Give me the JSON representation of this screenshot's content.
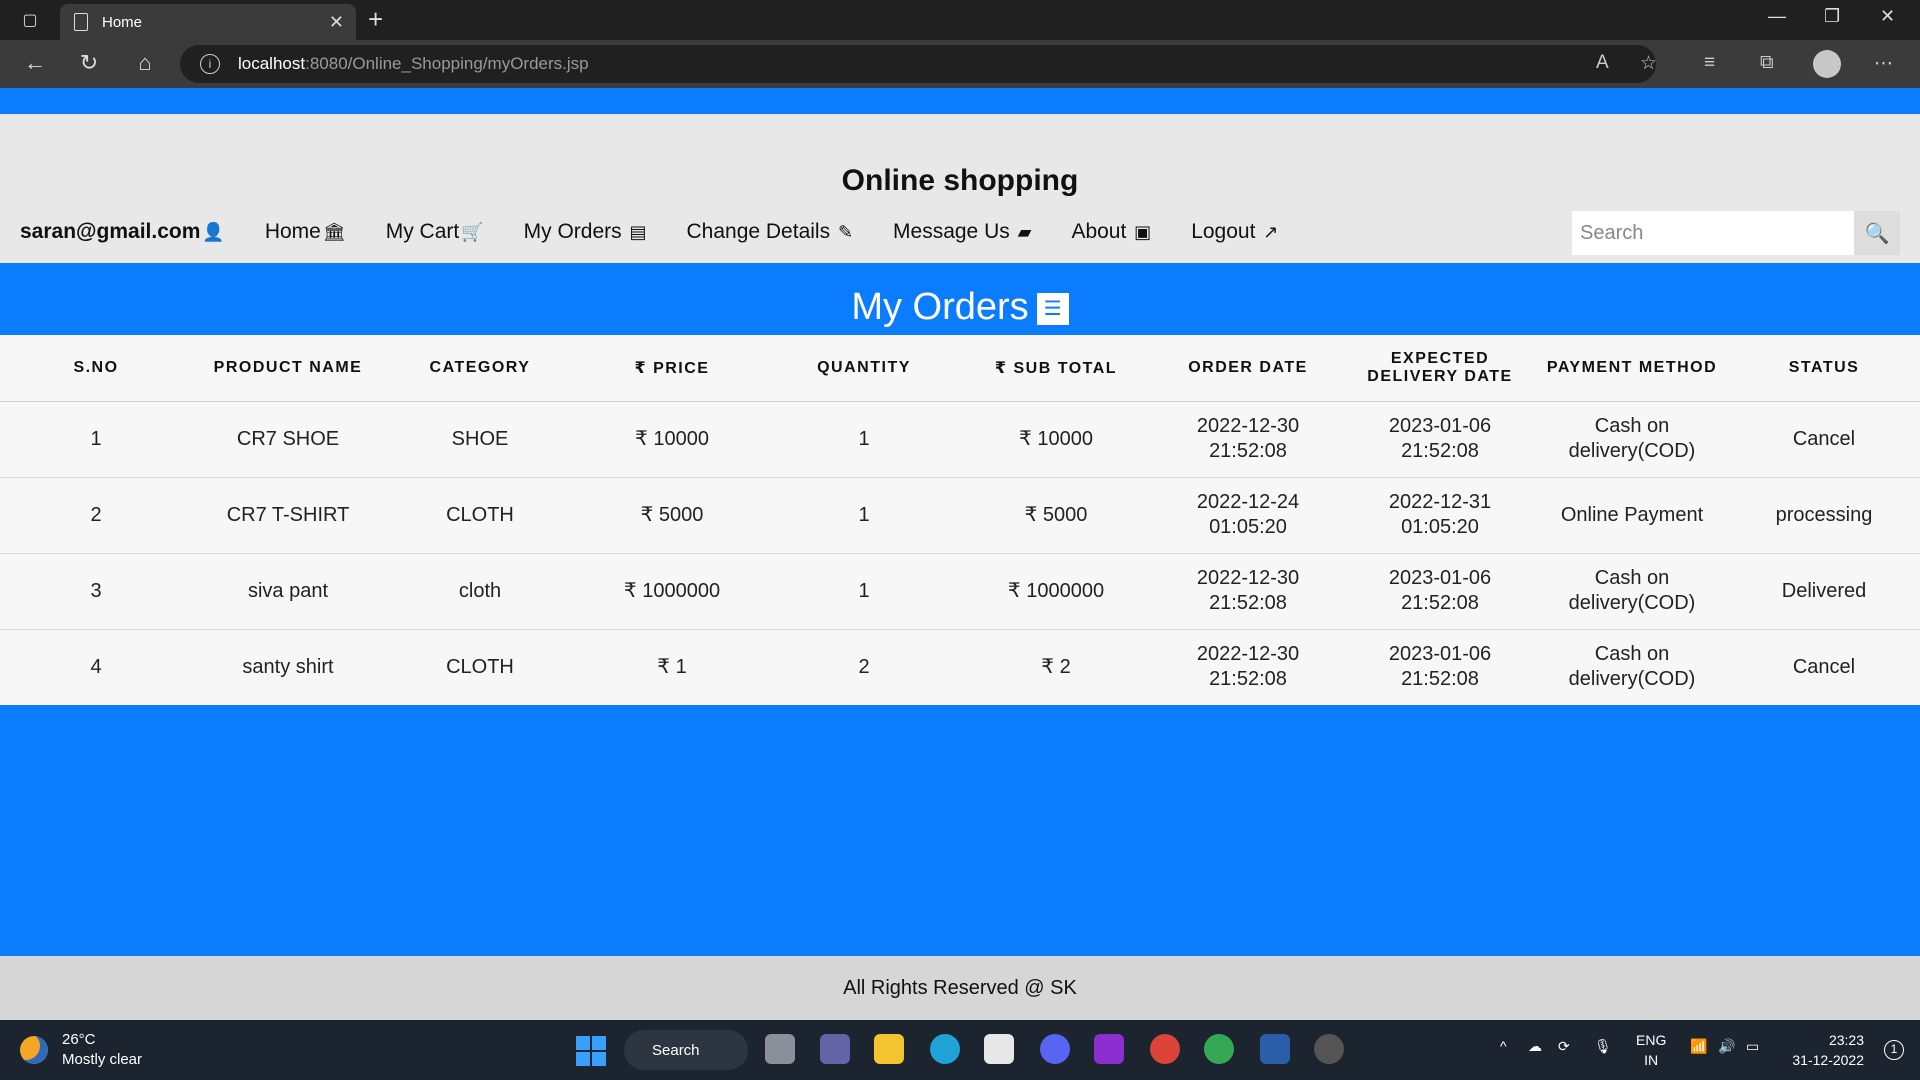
{
  "browser": {
    "tab_title": "Home",
    "url_host": "localhost",
    "url_path": ":8080/Online_Shopping/myOrders.jsp"
  },
  "site": {
    "title": "Online shopping",
    "user_email": "saran@gmail.com",
    "nav": [
      {
        "label": "Home",
        "icon": "bank-icon"
      },
      {
        "label": "My Cart",
        "icon": "cart-icon"
      },
      {
        "label": "My Orders",
        "icon": "list-alt-icon"
      },
      {
        "label": "Change Details",
        "icon": "edit-icon"
      },
      {
        "label": "Message Us",
        "icon": "comment-icon"
      },
      {
        "label": "About",
        "icon": "address-book-icon"
      },
      {
        "label": "Logout",
        "icon": "share-icon"
      }
    ],
    "search_placeholder": "Search"
  },
  "orders": {
    "title": "My Orders",
    "columns": [
      "S.NO",
      "PRODUCT NAME",
      "CATEGORY",
      "₹ PRICE",
      "QUANTITY",
      "₹ SUB TOTAL",
      "ORDER DATE",
      "EXPECTED DELIVERY DATE",
      "PAYMENT METHOD",
      "STATUS"
    ],
    "rows": [
      [
        "1",
        "CR7 SHOE",
        "SHOE",
        "₹ 10000",
        "1",
        "₹ 10000",
        "2022-12-30 21:52:08",
        "2023-01-06 21:52:08",
        "Cash on delivery(COD)",
        "Cancel"
      ],
      [
        "2",
        "CR7 T-SHIRT",
        "CLOTH",
        "₹ 5000",
        "1",
        "₹ 5000",
        "2022-12-24 01:05:20",
        "2022-12-31 01:05:20",
        "Online Payment",
        "processing"
      ],
      [
        "3",
        "siva pant",
        "cloth",
        "₹ 1000000",
        "1",
        "₹ 1000000",
        "2022-12-30 21:52:08",
        "2023-01-06 21:52:08",
        "Cash on delivery(COD)",
        "Delivered"
      ],
      [
        "4",
        "santy shirt",
        "CLOTH",
        "₹ 1",
        "2",
        "₹ 2",
        "2022-12-30 21:52:08",
        "2023-01-06 21:52:08",
        "Cash on delivery(COD)",
        "Cancel"
      ]
    ]
  },
  "footer": "All Rights Reserved @ SK",
  "taskbar": {
    "temp": "26°C",
    "weather": "Mostly clear",
    "search_label": "Search",
    "lang1": "ENG",
    "lang2": "IN",
    "time": "23:23",
    "date": "31-12-2022"
  },
  "colors": {
    "accent": "#0c7cff",
    "header_bg": "#e8e8e8"
  }
}
